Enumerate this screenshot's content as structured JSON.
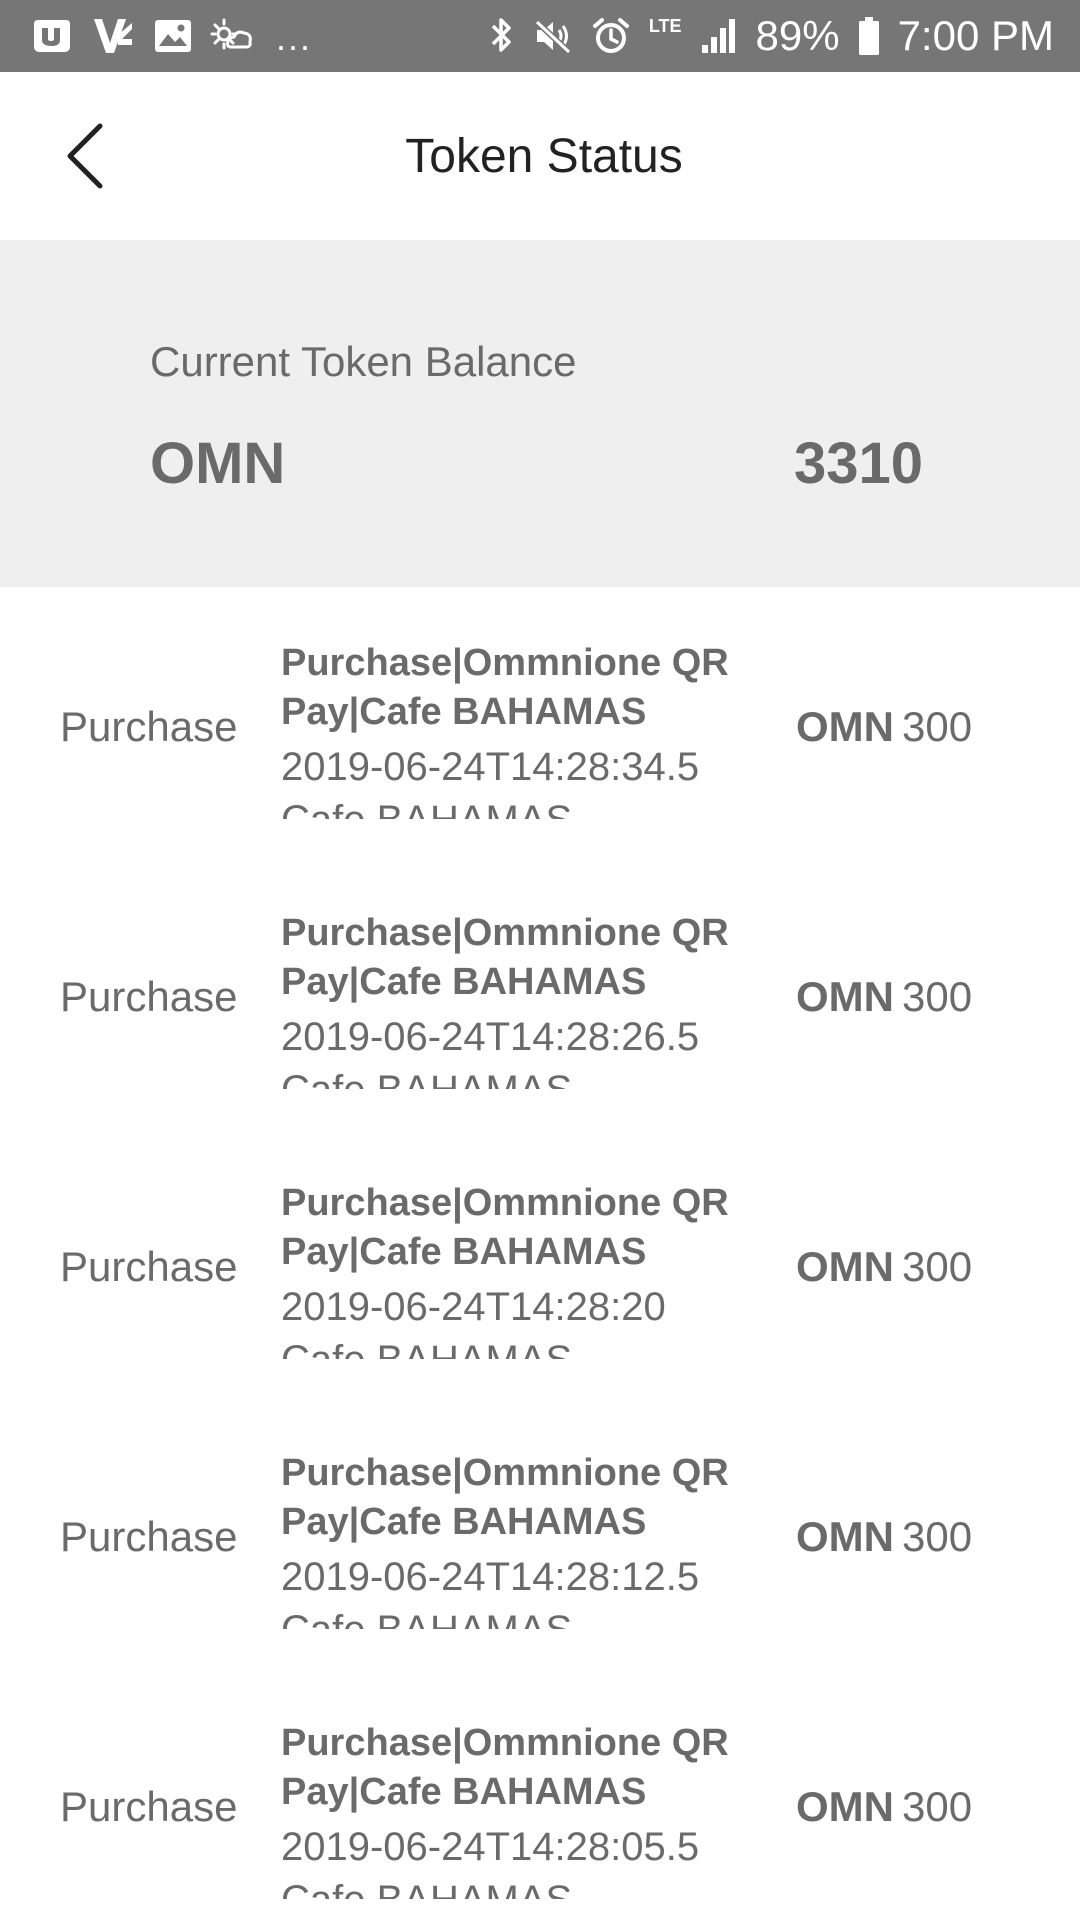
{
  "status_bar": {
    "battery": "89%",
    "time": "7:00 PM",
    "network": "LTE",
    "overflow": "...",
    "left_icons": [
      "brand-icon",
      "app-v-icon",
      "image-icon",
      "weather-icon"
    ],
    "right_icons": [
      "bluetooth-icon",
      "mute-icon",
      "alarm-icon",
      "signal-icon",
      "battery-icon"
    ]
  },
  "header": {
    "title": "Token Status",
    "back_icon": "back-arrow-icon"
  },
  "balance": {
    "label": "Current Token Balance",
    "currency": "OMN",
    "amount": "3310"
  },
  "transactions": [
    {
      "type": "Purchase",
      "title": "Purchase|Ommnione QR Pay|Cafe BAHAMAS",
      "date": "2019-06-24T14:28:34.5",
      "merchant": "Cafe BAHAMAS",
      "currency": "OMN",
      "amount": "300"
    },
    {
      "type": "Purchase",
      "title": "Purchase|Ommnione QR Pay|Cafe BAHAMAS",
      "date": "2019-06-24T14:28:26.5",
      "merchant": "Cafe BAHAMAS",
      "currency": "OMN",
      "amount": "300"
    },
    {
      "type": "Purchase",
      "title": "Purchase|Ommnione QR Pay|Cafe BAHAMAS",
      "date": "2019-06-24T14:28:20",
      "merchant": "Cafe BAHAMAS",
      "currency": "OMN",
      "amount": "300"
    },
    {
      "type": "Purchase",
      "title": "Purchase|Ommnione QR Pay|Cafe BAHAMAS",
      "date": "2019-06-24T14:28:12.5",
      "merchant": "Cafe BAHAMAS",
      "currency": "OMN",
      "amount": "300"
    },
    {
      "type": "Purchase",
      "title": "Purchase|Ommnione QR Pay|Cafe BAHAMAS",
      "date": "2019-06-24T14:28:05.5",
      "merchant": "Cafe BAHAMAS",
      "currency": "OMN",
      "amount": "300"
    }
  ],
  "colors": {
    "status_bar": "#767676",
    "card_background": "#efefef",
    "text_primary": "#222222",
    "text_secondary": "#6a6a6a"
  }
}
